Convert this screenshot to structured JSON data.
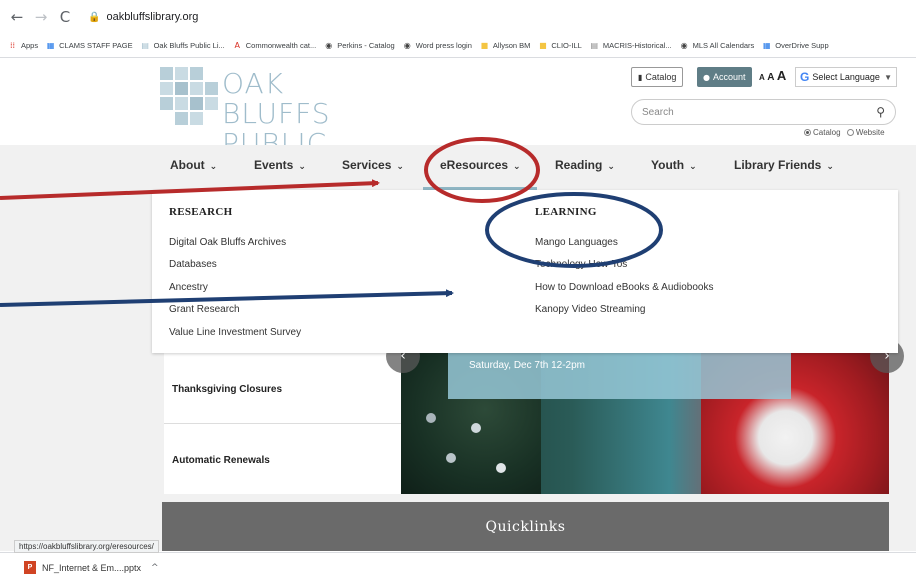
{
  "browser": {
    "back": "←",
    "forward": "→",
    "reload": "C",
    "url": "oakbluffslibrary.org",
    "status_url": "https://oakbluffslibrary.org/eresources/"
  },
  "bookmarks": [
    {
      "label": "Apps",
      "icon": "apps-grid-icon",
      "color": "#d93025"
    },
    {
      "label": "CLAMS STAFF PAGE",
      "icon": "calendar-icon",
      "color": "#1a73e8"
    },
    {
      "label": "Oak Bluffs Public Li...",
      "icon": "page-icon",
      "color": "#9fbccb"
    },
    {
      "label": "Commonwealth cat...",
      "icon": "adobe-icon",
      "color": "#d93025"
    },
    {
      "label": "Perkins - Catalog",
      "icon": "globe-icon",
      "color": "#444444"
    },
    {
      "label": "Word press login",
      "icon": "globe-icon",
      "color": "#444444"
    },
    {
      "label": "Allyson BM",
      "icon": "folder-icon",
      "color": "#f4c542"
    },
    {
      "label": "CLIO-ILL",
      "icon": "folder-icon",
      "color": "#f4c542"
    },
    {
      "label": "MACRIS-Historical...",
      "icon": "page-icon",
      "color": "#888888"
    },
    {
      "label": "MLS All Calendars",
      "icon": "globe-icon",
      "color": "#444444"
    },
    {
      "label": "OverDrive Supp",
      "icon": "calendar-icon",
      "color": "#1a73e8"
    }
  ],
  "header": {
    "logo_line1": "OAK BLUFFS",
    "logo_line2": "PUBLIC LIBRARY",
    "catalog_button": "Catalog",
    "account_button": "Account",
    "font_small": "A",
    "font_medium": "A",
    "font_large": "A",
    "select_language": "Select Language",
    "search_placeholder": "Search",
    "radio_catalog": "Catalog",
    "radio_website": "Website"
  },
  "nav": [
    {
      "label": "About"
    },
    {
      "label": "Events"
    },
    {
      "label": "Services"
    },
    {
      "label": "eResources"
    },
    {
      "label": "Reading"
    },
    {
      "label": "Youth"
    },
    {
      "label": "Library Friends"
    }
  ],
  "dropdown": {
    "research_heading": "RESEARCH",
    "research_links": [
      "Digital Oak Bluffs Archives",
      "Databases",
      "Ancestry",
      "Grant Research",
      "Value Line Investment Survey"
    ],
    "learning_heading": "LEARNING",
    "learning_links": [
      "Mango Languages",
      "Technology How-Tos",
      "How to Download eBooks & Audiobooks",
      "Kanopy Video Streaming"
    ]
  },
  "content": {
    "sidebar_items": [
      "Thanksgiving Closures",
      "Automatic Renewals"
    ],
    "hero_text": "Saturday, Dec 7th  12-2pm",
    "prev_arrow": "‹",
    "next_arrow": "›",
    "quicklinks": "Quicklinks"
  },
  "download": {
    "filename": "NF_Internet & Em....pptx",
    "chevron": "^"
  },
  "annotation_colors": {
    "red": "#b72b2b",
    "blue": "#1f3f73"
  }
}
